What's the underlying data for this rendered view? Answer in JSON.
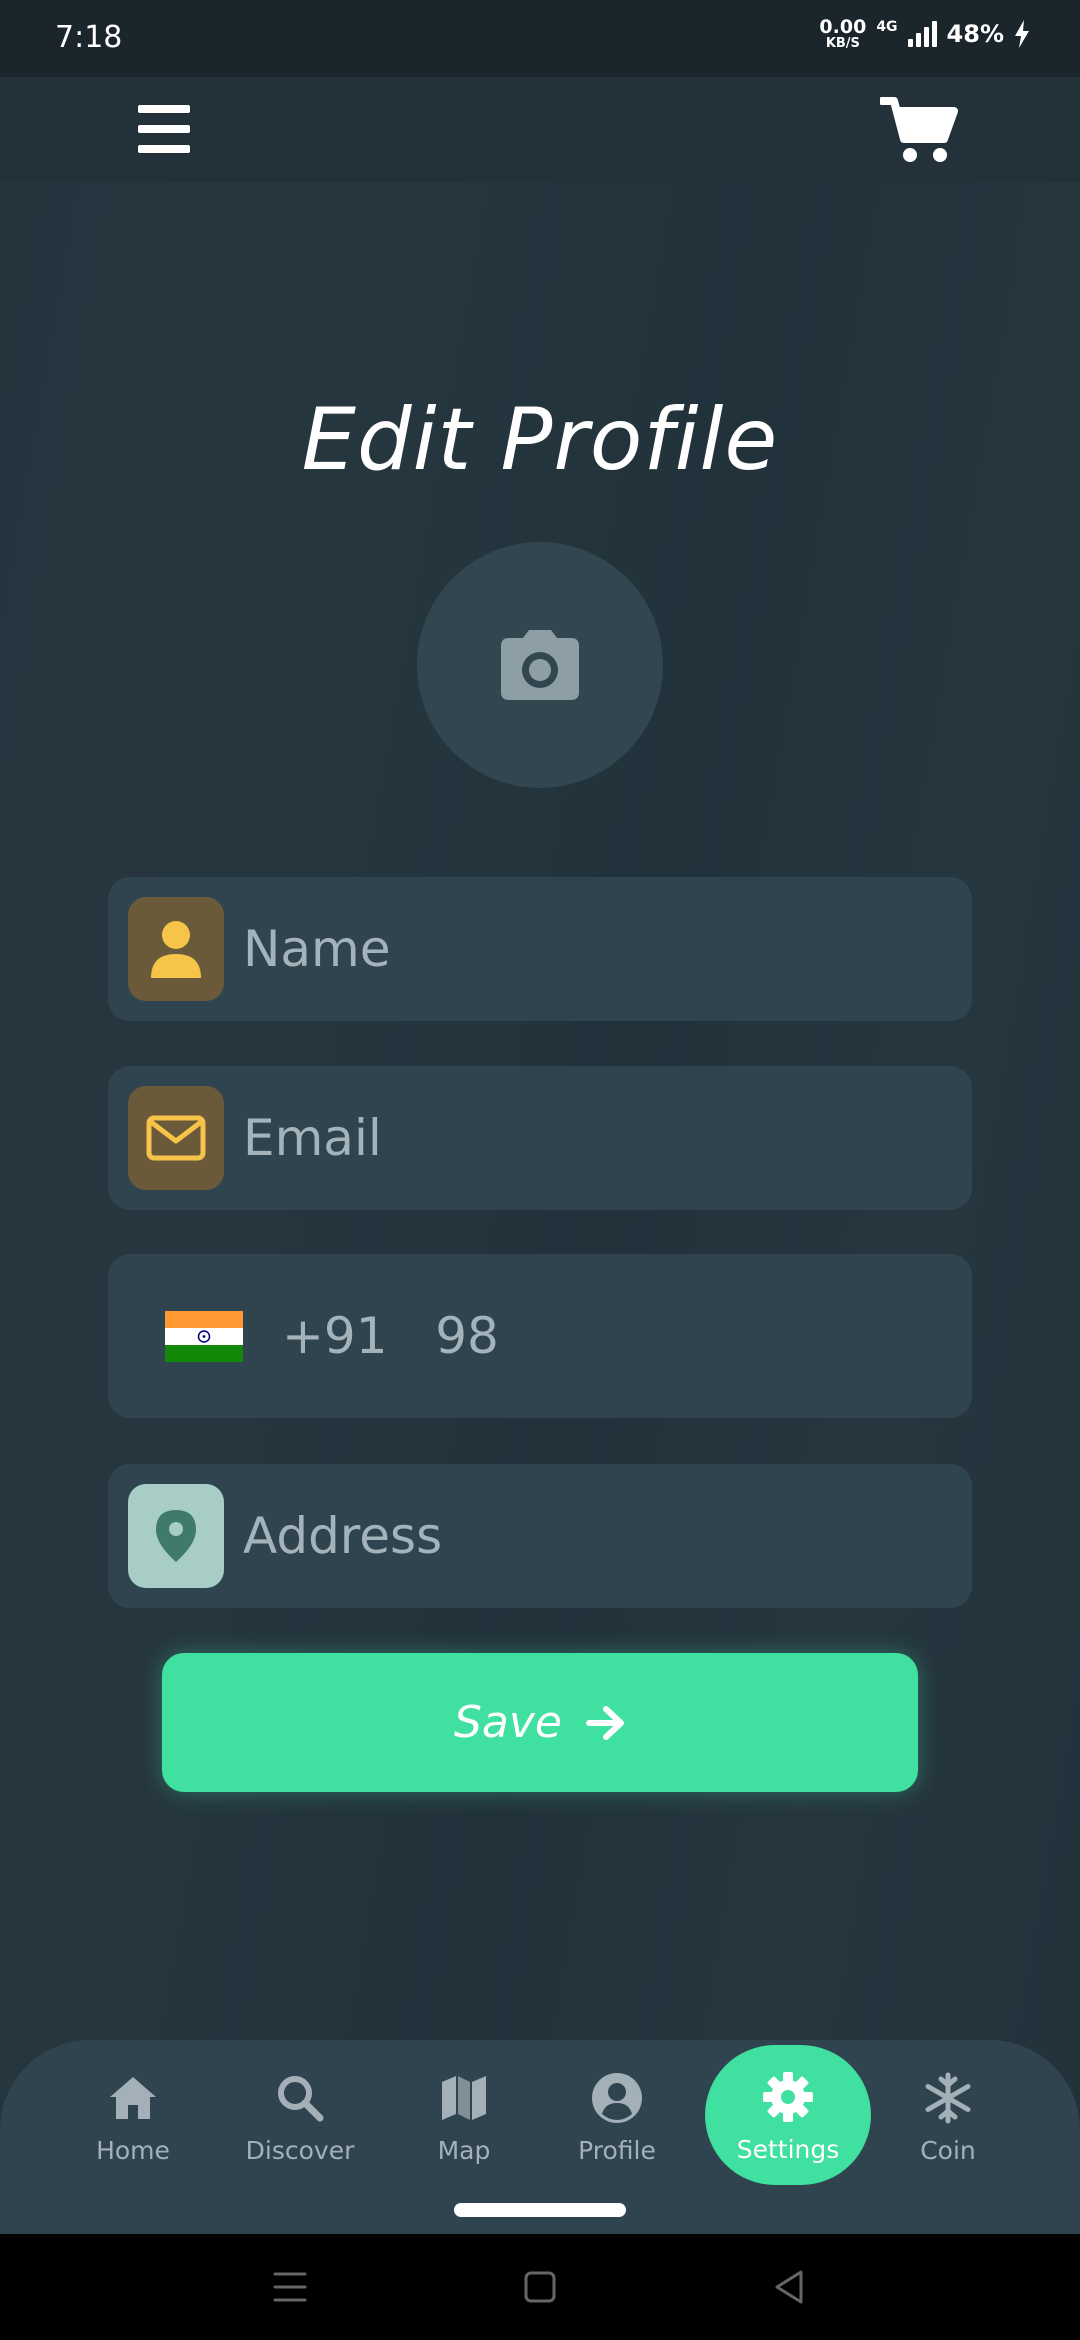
{
  "status_bar": {
    "time": "7:18",
    "net_speed_value": "0.00",
    "net_speed_unit": "KB/S",
    "network_type": "4G",
    "battery": "48%"
  },
  "app_bar": {
    "menu_icon": "hamburger-menu-icon",
    "cart_icon": "shopping-cart-icon"
  },
  "page": {
    "title": "Edit Profile",
    "avatar_icon": "camera-icon"
  },
  "form": {
    "name": {
      "placeholder": "Name",
      "icon": "person-icon"
    },
    "email": {
      "placeholder": "Email",
      "icon": "envelope-icon"
    },
    "phone": {
      "country_flag": "india-flag",
      "code": "+91",
      "value": "98"
    },
    "address": {
      "placeholder": "Address",
      "icon": "location-pin-icon"
    },
    "save_label": "Save"
  },
  "bottom_nav": {
    "items": [
      {
        "label": "Home",
        "icon": "home-icon"
      },
      {
        "label": "Discover",
        "icon": "search-icon"
      },
      {
        "label": "Map",
        "icon": "map-icon"
      },
      {
        "label": "Profile",
        "icon": "user-circle-icon"
      },
      {
        "label": "Settings",
        "icon": "gear-icon",
        "active": true
      },
      {
        "label": "Coin",
        "icon": "snowflake-icon"
      }
    ]
  },
  "colors": {
    "background": "#22313a",
    "field": "#30444f",
    "accent": "#40e0a0",
    "icon_gold": "#f7c44a",
    "icon_gold_bg": "#6b5a3a",
    "icon_pin_bg": "#a8cdc6",
    "icon_pin": "#3f7a6c"
  }
}
